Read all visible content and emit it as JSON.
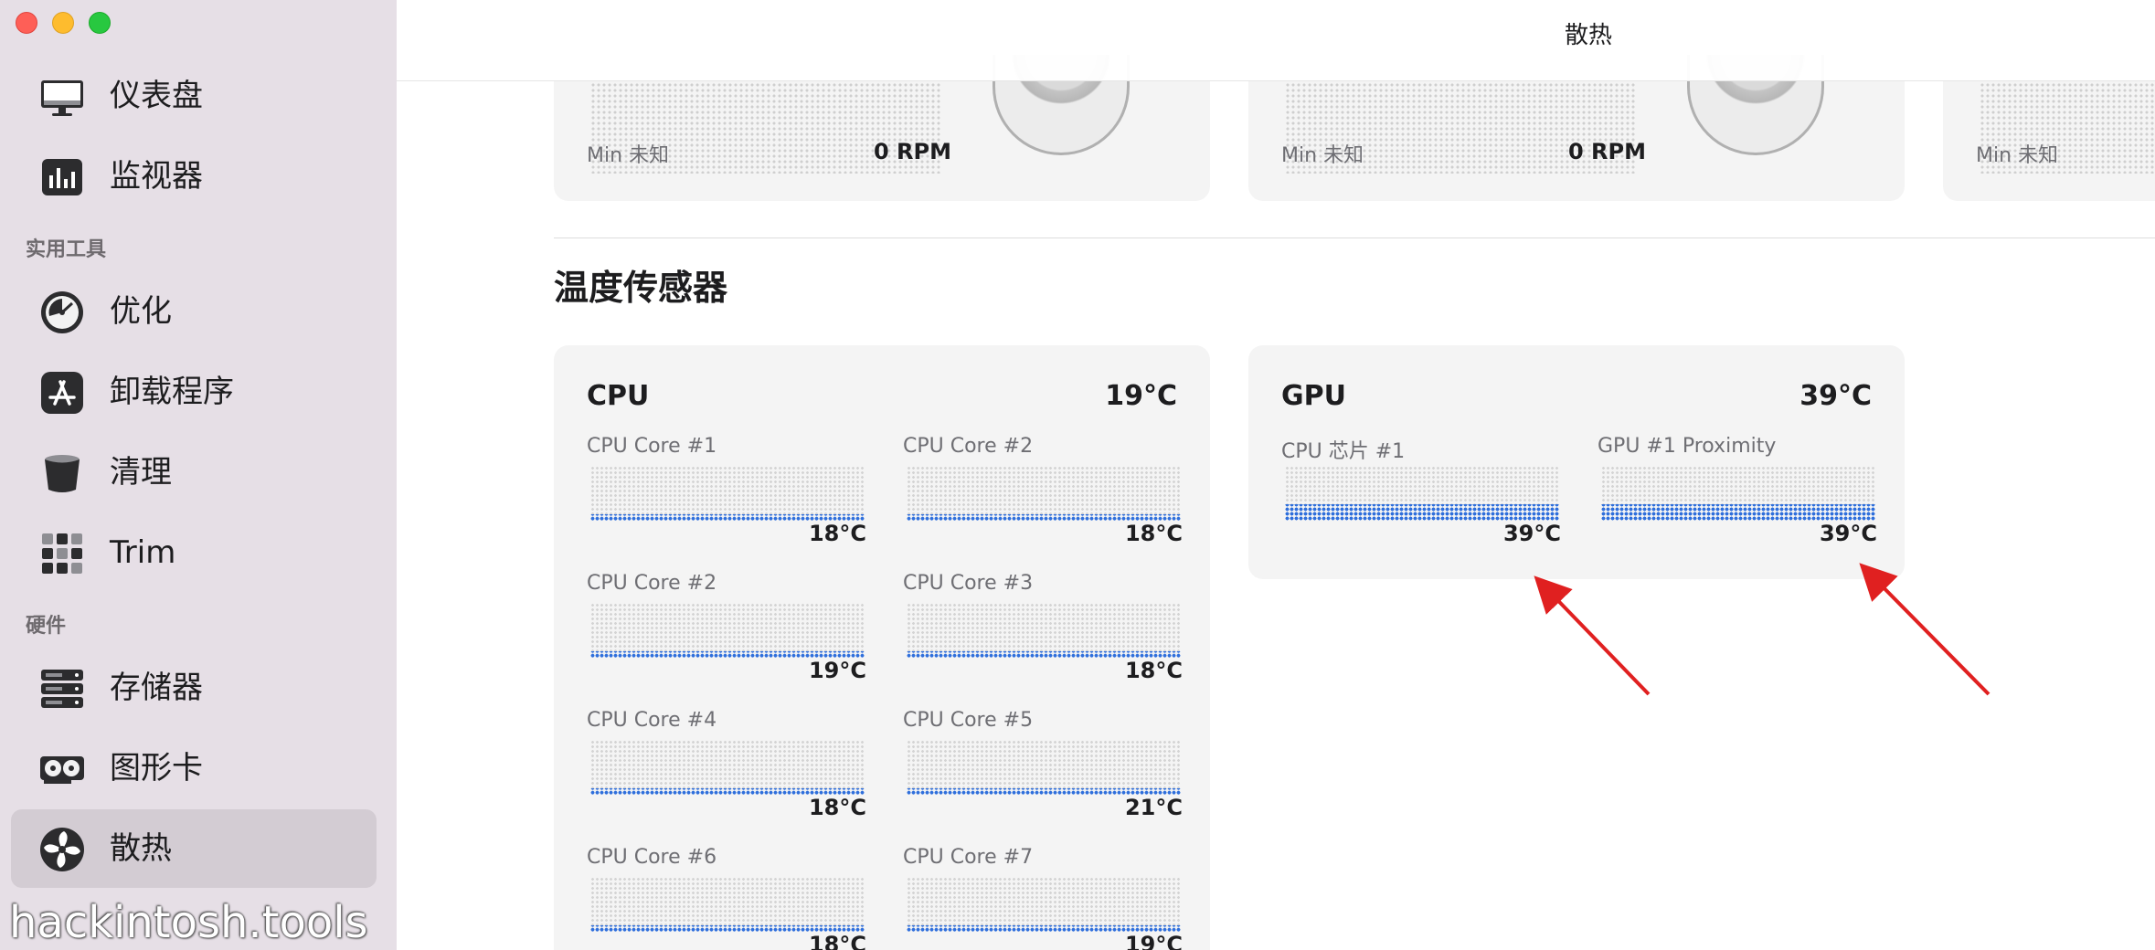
{
  "window": {
    "title": "散热"
  },
  "sidebar": {
    "items_top": [
      {
        "label": "仪表盘",
        "icon": "monitor-icon"
      },
      {
        "label": "监视器",
        "icon": "bar-chart-icon"
      }
    ],
    "section_tools": "实用工具",
    "items_tools": [
      {
        "label": "优化",
        "icon": "gauge-icon"
      },
      {
        "label": "卸载程序",
        "icon": "app-store-icon"
      },
      {
        "label": "清理",
        "icon": "trash-icon"
      },
      {
        "label": "Trim",
        "icon": "grid-icon"
      }
    ],
    "section_hardware": "硬件",
    "items_hardware": [
      {
        "label": "存储器",
        "icon": "server-icon"
      },
      {
        "label": "图形卡",
        "icon": "gpu-card-icon"
      },
      {
        "label": "散热",
        "icon": "fan-icon",
        "active": true
      }
    ]
  },
  "watermark": "hackintosh.tools",
  "fans": [
    {
      "min": "Min 未知",
      "rpm": "0 RPM"
    },
    {
      "min": "Min 未知",
      "rpm": "0 RPM"
    },
    {
      "min": "Min 未知",
      "rpm": ""
    }
  ],
  "temperature": {
    "section_title": "温度传感器",
    "groups": [
      {
        "name": "CPU",
        "temp": "19°C",
        "sensors": [
          {
            "label": "CPU Core #1",
            "value": "18°C",
            "level": 0.12
          },
          {
            "label": "CPU Core #2",
            "value": "18°C",
            "level": 0.12
          },
          {
            "label": "CPU Core #2",
            "value": "19°C",
            "level": 0.12
          },
          {
            "label": "CPU Core #3",
            "value": "18°C",
            "level": 0.12
          },
          {
            "label": "CPU Core #4",
            "value": "18°C",
            "level": 0.12
          },
          {
            "label": "CPU Core #5",
            "value": "21°C",
            "level": 0.12
          },
          {
            "label": "CPU Core #6",
            "value": "18°C",
            "level": 0.12
          },
          {
            "label": "CPU Core #7",
            "value": "19°C",
            "level": 0.12
          }
        ]
      },
      {
        "name": "GPU",
        "temp": "39°C",
        "sensors": [
          {
            "label": "CPU 芯片 #1",
            "value": "39°C",
            "level": 0.3
          },
          {
            "label": "GPU #1 Proximity",
            "value": "39°C",
            "level": 0.3
          }
        ]
      }
    ]
  },
  "colors": {
    "accent": "#2f6fdc",
    "annotation_arrow": "#e02020",
    "sidebar_bg": "#e6dfe6"
  }
}
